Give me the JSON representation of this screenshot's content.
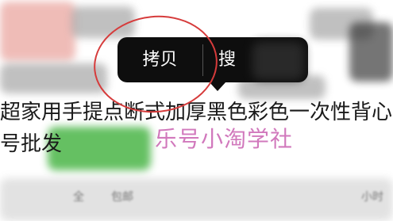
{
  "context_menu": {
    "copy_label": "拷贝",
    "second_label": "搜"
  },
  "product": {
    "title_line1": "超家用手提点断式加厚黑色彩色一次性背心排",
    "title_line2": "号批发"
  },
  "watermark": {
    "text": "乐号小淘学社"
  },
  "footer": {
    "left": "全",
    "middle": "包邮",
    "right": "小时"
  },
  "annotation_color": "#d63b3b"
}
